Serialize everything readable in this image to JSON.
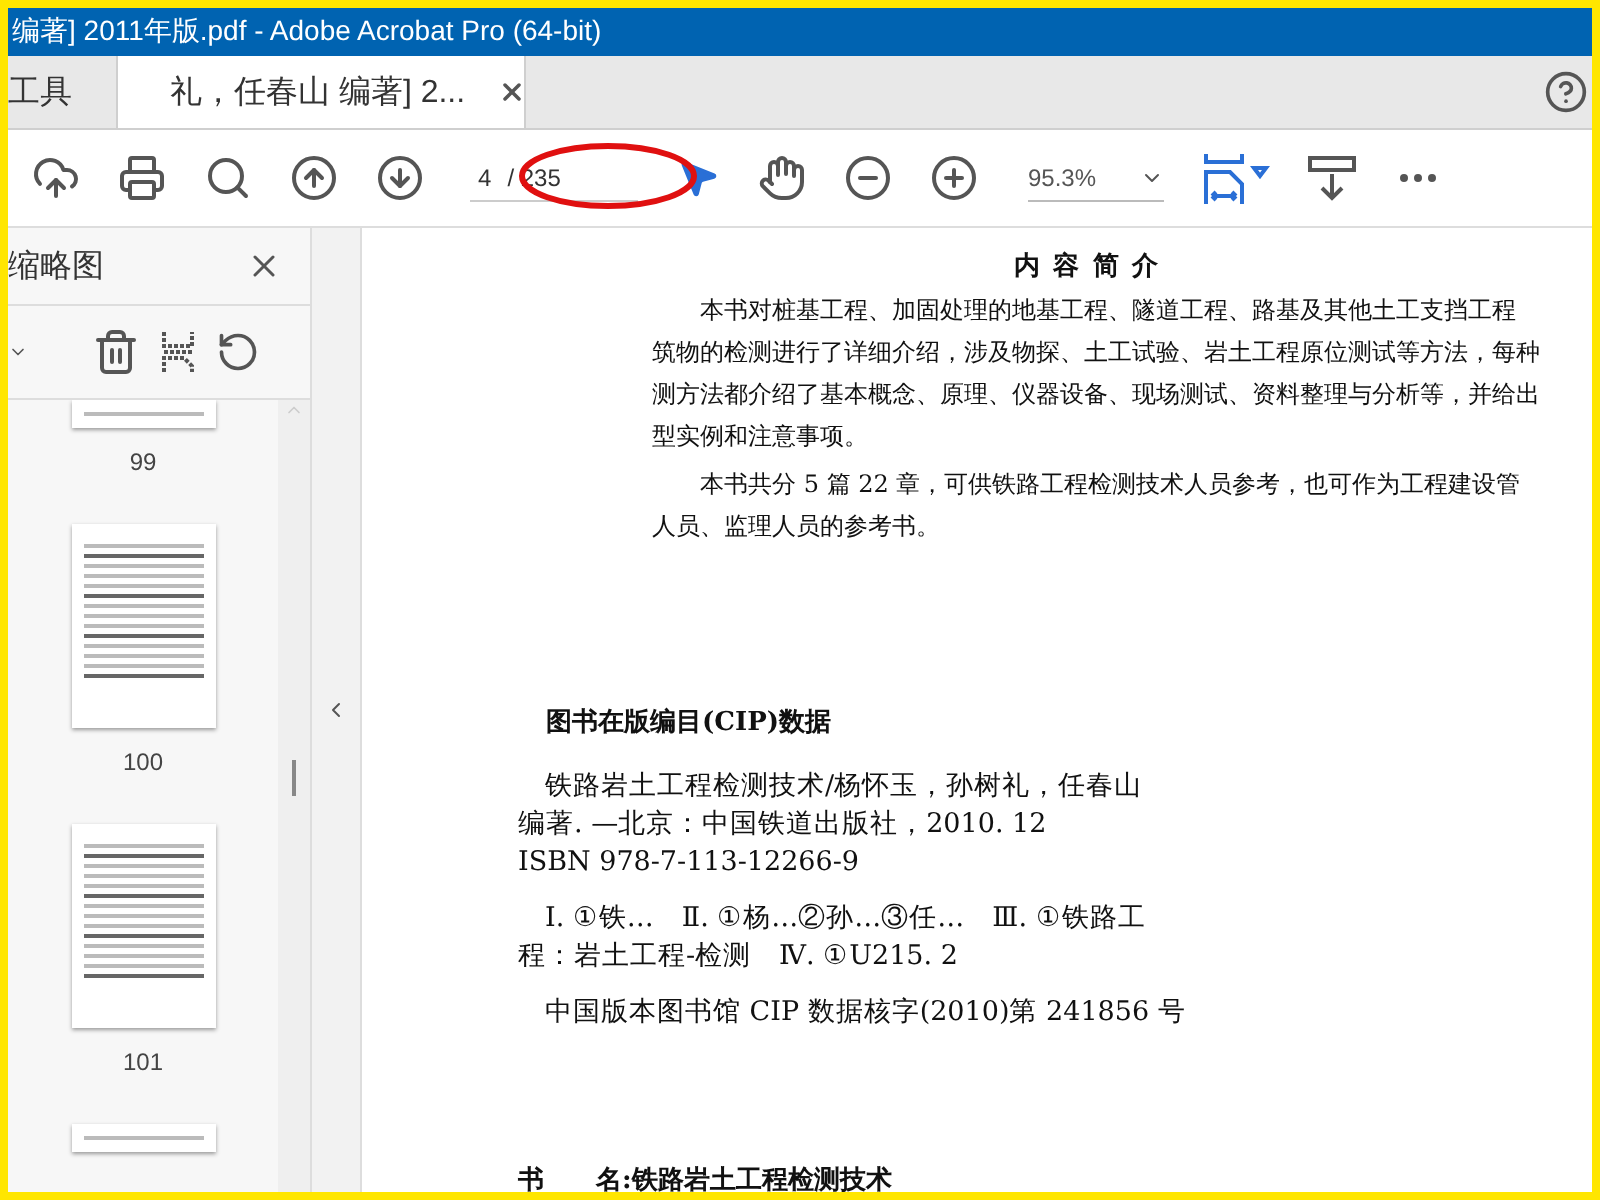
{
  "window": {
    "title": "编著] 2011年版.pdf - Adobe Acrobat Pro (64-bit)"
  },
  "tabs": [
    {
      "label": "工具",
      "selected": false
    },
    {
      "label": "礼，任春山 编著] 2...",
      "selected": true
    }
  ],
  "toolbar": {
    "page_current": "4",
    "page_total": "/ 235",
    "zoom": "95.3%"
  },
  "sidebar": {
    "title": "缩略图",
    "thumbnails": [
      {
        "label": "99",
        "kind": "cut"
      },
      {
        "label": "100",
        "kind": "full"
      },
      {
        "label": "101",
        "kind": "full"
      },
      {
        "kind": "cut"
      }
    ]
  },
  "document": {
    "heading": "内 容 简 介",
    "paragraphs": [
      [
        "本书对桩基工程、加固处理的地基工程、隧道工程、路基及其他土工支挡工程",
        "筑物的检测进行了详细介绍，涉及物探、土工试验、岩土工程原位测试等方法，每种",
        "测方法都介绍了基本概念、原理、仪器设备、现场测试、资料整理与分析等，并给出",
        "型实例和注意事项。"
      ],
      [
        "本书共分 5 篇 22 章，可供铁路工程检测技术人员参考，也可作为工程建设管",
        "人员、监理人员的参考书。"
      ]
    ],
    "cip_title": "图书在版编目(CIP)数据",
    "cip_blocks": [
      [
        "铁路岩土工程检测技术/杨怀玉，孙树礼，任春山",
        "编著. —北京：中国铁道出版社，2010. 12",
        "ISBN 978-7-113-12266-9"
      ],
      [
        "Ⅰ. ①铁…　Ⅱ. ①杨…②孙…③任…　Ⅲ. ①铁路工",
        "程：岩土工程-检测　Ⅳ. ①U215. 2"
      ],
      [
        "中国版本图书馆 CIP 数据核字(2010)第 241856 号"
      ]
    ],
    "book_label": "书　　名:",
    "book_value": "铁路岩土工程检测技术"
  }
}
